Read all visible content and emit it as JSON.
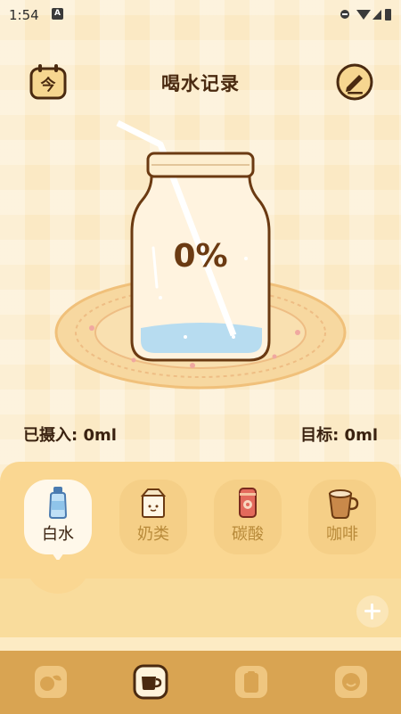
{
  "status_bar": {
    "time": "1:54",
    "notification_icon": "A"
  },
  "header": {
    "title": "喝水记录",
    "calendar_button_glyph": "今",
    "calendar_icon": "calendar-today-icon",
    "edit_icon": "edit-icon"
  },
  "progress": {
    "percent_label": "0%",
    "fraction": 0.0
  },
  "stats": {
    "intake": "已摄入: 0ml",
    "target": "目标: 0ml"
  },
  "drinks": [
    {
      "label": "白水",
      "icon": "water-bottle-icon",
      "selected": true
    },
    {
      "label": "奶类",
      "icon": "milk-carton-icon",
      "selected": false
    },
    {
      "label": "碳酸",
      "icon": "soda-can-icon",
      "selected": false
    },
    {
      "label": "咖啡",
      "icon": "coffee-cup-icon",
      "selected": false
    }
  ],
  "bottom_nav": [
    {
      "icon": "fruit-icon",
      "selected": false
    },
    {
      "icon": "cup-icon",
      "selected": true
    },
    {
      "icon": "clipboard-icon",
      "selected": false
    },
    {
      "icon": "smiley-icon",
      "selected": false
    }
  ],
  "colors": {
    "background": "#fbe9c4",
    "panel": "#fad792",
    "nav": "#d9a452",
    "accent": "#6b3a12",
    "water": "#b7dcf0"
  }
}
